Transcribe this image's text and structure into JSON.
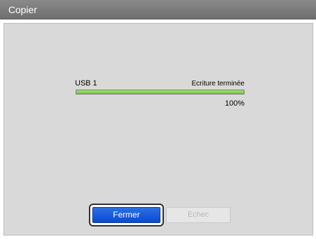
{
  "window": {
    "title": "Copier"
  },
  "device": {
    "name": "USB 1",
    "status": "Ecriture terminée",
    "progress_fraction": 1.0,
    "progress_label": "100%"
  },
  "buttons": {
    "close_label": "Fermer",
    "fail_label": "Echec"
  },
  "colors": {
    "titlebar": "#7a7a7a",
    "panel": "#d9d9d9",
    "progress": "#6cc63a",
    "primary_button": "#0a4bd0"
  }
}
